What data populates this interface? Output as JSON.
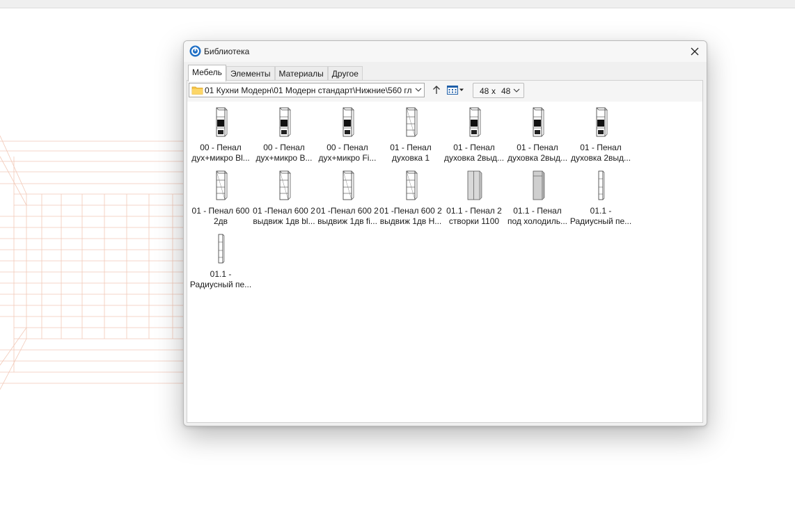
{
  "window": {
    "title": "Библиотека"
  },
  "tabs": [
    {
      "label": "Мебель",
      "active": true
    },
    {
      "label": "Элементы",
      "active": false
    },
    {
      "label": "Материалы",
      "active": false
    },
    {
      "label": "Другое",
      "active": false
    }
  ],
  "toolbar": {
    "path": "01 Кухни Модерн\\01 Модерн стандарт\\Нижние\\560 гл",
    "thumb_size": {
      "width": "48",
      "x": "x",
      "height": "48"
    }
  },
  "items": [
    {
      "line1": "00 - Пенал",
      "line2": "дух+микро Bl...",
      "icon": "cabinet-oven-icon"
    },
    {
      "line1": "00 - Пенал",
      "line2": "дух+микро B...",
      "icon": "cabinet-oven-icon"
    },
    {
      "line1": "00 - Пенал",
      "line2": "дух+микро Fi...",
      "icon": "cabinet-oven-icon"
    },
    {
      "line1": "01 -  Пенал",
      "line2": "духовка 1",
      "icon": "cabinet-wire-icon"
    },
    {
      "line1": "01 -  Пенал",
      "line2": "духовка 2выд...",
      "icon": "cabinet-oven-icon"
    },
    {
      "line1": "01 -  Пенал",
      "line2": "духовка 2выд...",
      "icon": "cabinet-oven-icon"
    },
    {
      "line1": "01 -  Пенал",
      "line2": "духовка 2выд...",
      "icon": "cabinet-oven-icon"
    },
    {
      "line1": "01 - Пенал 600",
      "line2": "2дв",
      "icon": "cabinet-wire-icon"
    },
    {
      "line1": "01 -Пенал 600 2",
      "line2": "выдвиж 1дв bl...",
      "icon": "cabinet-wire-icon"
    },
    {
      "line1": "01 -Пенал 600 2",
      "line2": "выдвиж 1дв fi...",
      "icon": "cabinet-wire-icon"
    },
    {
      "line1": "01 -Пенал 600 2",
      "line2": "выдвиж 1дв Н...",
      "icon": "cabinet-wire-icon"
    },
    {
      "line1": "01.1 - Пенал 2",
      "line2": "створки 1100",
      "icon": "cabinet-wide-icon"
    },
    {
      "line1": "01.1 - Пенал",
      "line2": "под холодиль...",
      "icon": "cabinet-fridge-icon"
    },
    {
      "line1": "01.1 -",
      "line2": "Радиусный пе...",
      "icon": "cabinet-narrow-icon"
    },
    {
      "line1": "01.1 -",
      "line2": "Радиусный пе...",
      "icon": "cabinet-narrow-icon"
    }
  ]
}
